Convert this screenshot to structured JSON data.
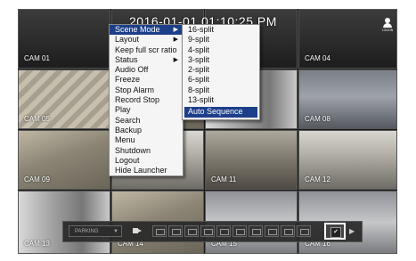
{
  "timestamp": "2016-01-01 01:10:25 PM",
  "logon_label": "LOGON",
  "cameras": [
    {
      "id": "cam-01",
      "label": "CAM 01"
    },
    {
      "id": "cam-04",
      "label": "CAM 04"
    },
    {
      "id": "cam-05",
      "label": "CAM 05"
    },
    {
      "id": "cam-08",
      "label": "CAM 08"
    },
    {
      "id": "cam-09",
      "label": "CAM 09"
    },
    {
      "id": "cam-11",
      "label": "CAM 11"
    },
    {
      "id": "cam-12",
      "label": "CAM 12"
    },
    {
      "id": "cam-13",
      "label": "CAM 13"
    },
    {
      "id": "cam-14",
      "label": "CAM 14"
    },
    {
      "id": "cam-15",
      "label": "CAM 15"
    },
    {
      "id": "cam-16",
      "label": "CAM 16"
    }
  ],
  "main_menu": {
    "items": [
      {
        "label": "Scene Mode",
        "submenu": true,
        "active": true
      },
      {
        "label": "Layout",
        "submenu": true
      },
      {
        "label": "Keep full scr ratio"
      },
      {
        "label": "Status",
        "submenu": true
      },
      {
        "label": "Audio Off"
      },
      {
        "label": "Freeze"
      },
      {
        "label": "Stop Alarm"
      },
      {
        "label": "Record Stop"
      },
      {
        "label": "Play"
      },
      {
        "label": "Search"
      },
      {
        "label": "Backup"
      },
      {
        "label": "Menu"
      },
      {
        "label": "Shutdown"
      },
      {
        "label": "Logout"
      },
      {
        "label": "Hide Launcher"
      }
    ]
  },
  "submenu_arrow": "▶",
  "scene_mode_menu": {
    "items": [
      {
        "label": "16-split"
      },
      {
        "label": "9-split"
      },
      {
        "label": "4-split"
      },
      {
        "label": "3-split"
      },
      {
        "label": "2-split"
      },
      {
        "label": "6-split"
      },
      {
        "label": "8-split"
      },
      {
        "label": "13-split"
      },
      {
        "label": "Auto Sequence",
        "highlight": true
      }
    ]
  },
  "launcher": {
    "mode_select": "PARKING",
    "mode_caret": "▼",
    "next_arrow": "▶",
    "check_mark": "✔"
  },
  "colors": {
    "menu_highlight": "#1d3f8a",
    "menu_background": "#f5f5f5"
  },
  "icons": [
    "logon-icon",
    "camera-icon",
    "chevron-right-icon",
    "chevron-down-icon",
    "check-icon"
  ]
}
